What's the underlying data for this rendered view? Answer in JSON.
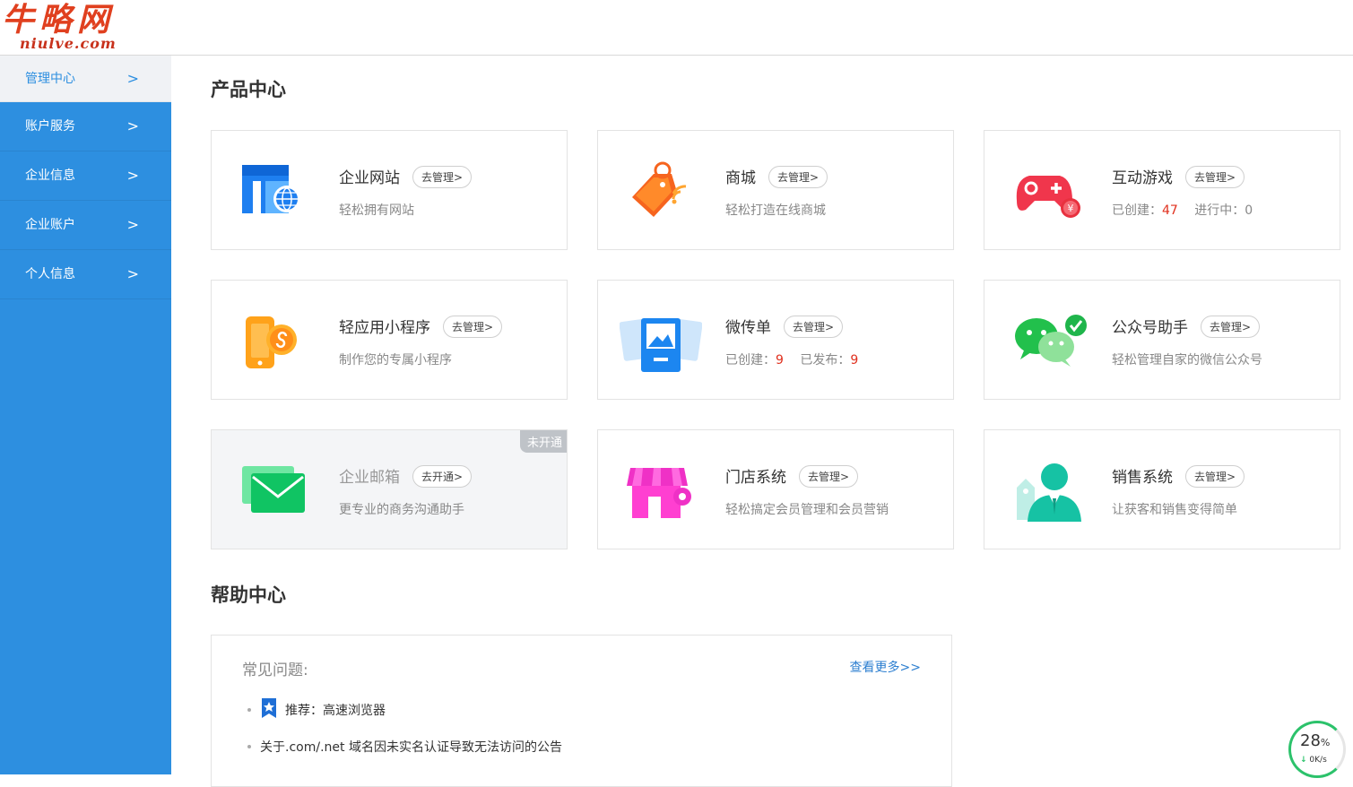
{
  "logo": {
    "cn": "牛略网",
    "en": "niulve.com"
  },
  "sidebar": {
    "items": [
      {
        "label": "管理中心",
        "chevron": ">"
      },
      {
        "label": "账户服务",
        "chevron": ">"
      },
      {
        "label": "企业信息",
        "chevron": ">"
      },
      {
        "label": "企业账户",
        "chevron": ">"
      },
      {
        "label": "个人信息",
        "chevron": ">"
      }
    ]
  },
  "products": {
    "title": "产品中心",
    "cards": [
      {
        "name": "企业网站",
        "button": "去管理>",
        "desc": "轻松拥有网站",
        "icon": "website-icon"
      },
      {
        "name": "商城",
        "button": "去管理>",
        "desc": "轻松打造在线商城",
        "icon": "shopping-tag-icon"
      },
      {
        "name": "互动游戏",
        "button": "去管理>",
        "stats": {
          "created_label": "已创建：",
          "created": "47",
          "running_label": "进行中：",
          "running": "0"
        },
        "icon": "gamepad-icon"
      },
      {
        "name": "轻应用小程序",
        "button": "去管理>",
        "desc": "制作您的专属小程序",
        "icon": "mini-program-icon"
      },
      {
        "name": "微传单",
        "button": "去管理>",
        "stats": {
          "created_label": "已创建：",
          "created": "9",
          "published_label": "已发布：",
          "published": "9"
        },
        "icon": "flyer-icon"
      },
      {
        "name": "公众号助手",
        "button": "去管理>",
        "desc": "轻松管理自家的微信公众号",
        "icon": "wechat-icon"
      },
      {
        "name": "企业邮箱",
        "button": "去开通>",
        "desc": "更专业的商务沟通助手",
        "badge": "未开通",
        "icon": "mail-icon"
      },
      {
        "name": "门店系统",
        "button": "去管理>",
        "desc": "轻松搞定会员管理和会员营销",
        "icon": "store-icon"
      },
      {
        "name": "销售系统",
        "button": "去管理>",
        "desc": "让获客和销售变得简单",
        "icon": "salesperson-icon"
      }
    ]
  },
  "help": {
    "title": "帮助中心",
    "faq_label": "常见问题:",
    "more": "查看更多>>",
    "items": [
      "推荐：高速浏览器",
      "关于.com/.net 域名因未实名认证导致无法访问的公告"
    ]
  },
  "speed_widget": {
    "percent": "28",
    "unit": "%",
    "rate": "0K/s"
  },
  "colors": {
    "sidebar": "#2d8fe0",
    "accent_red": "#e0301e",
    "link": "#2d7fd0"
  }
}
